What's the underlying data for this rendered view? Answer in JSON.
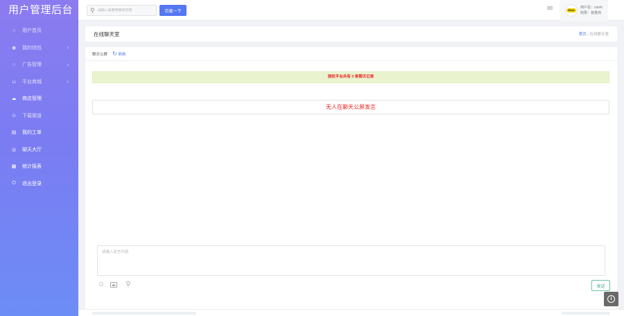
{
  "app": {
    "title": "用户管理后台"
  },
  "sidebar": {
    "items": [
      {
        "icon": "home-icon",
        "glyph": "○",
        "label": "用户首页",
        "has_arrow": false
      },
      {
        "icon": "wallet-icon",
        "glyph": "◉",
        "label": "我的钱包",
        "has_arrow": true
      },
      {
        "icon": "ad-icon",
        "glyph": "○",
        "label": "广告管理",
        "has_arrow": true
      },
      {
        "icon": "cart-icon",
        "glyph": "⊔",
        "label": "平台商城",
        "has_arrow": true
      },
      {
        "icon": "cloud-icon",
        "glyph": "☁",
        "label": "商店管理",
        "has_arrow": false
      },
      {
        "icon": "download-icon",
        "glyph": "⊙",
        "label": "下载渠道",
        "has_arrow": false
      },
      {
        "icon": "ticket-icon",
        "glyph": "▤",
        "label": "我的工单",
        "has_arrow": false
      },
      {
        "icon": "group-icon",
        "glyph": "◎",
        "label": "聊天大厅",
        "has_arrow": false
      },
      {
        "icon": "stats-icon",
        "glyph": "▦",
        "label": "统计报表",
        "has_arrow": false
      },
      {
        "icon": "logout-icon",
        "glyph": "⏻",
        "label": "退出登录",
        "has_arrow": false
      }
    ]
  },
  "header": {
    "search_placeholder": "请输入需要搜索的内容",
    "search_button": "百度一下",
    "user_line1": "用户名：cashi",
    "user_line2": "权限：普惠商",
    "avatar_text": "Bitst"
  },
  "page": {
    "title": "在线聊天室",
    "breadcrumb_home": "首页",
    "breadcrumb_sep": "/",
    "breadcrumb_current": "在线聊天室"
  },
  "panel": {
    "tab_label": "聊天公屏",
    "refresh_label": "刷新",
    "alert": "授权平台共有 0 条聊天记录",
    "empty": "无人在聊天公屏发言",
    "input_placeholder": "请输入发言内容",
    "send_label": "发送"
  },
  "colors": {
    "sidebar_top": "#8b7bf0",
    "sidebar_bottom": "#6c8df5",
    "accent": "#5577f2",
    "alert_bg": "#e9f4cf",
    "alert_text": "#e22222",
    "send_border": "#6fbfa3"
  }
}
